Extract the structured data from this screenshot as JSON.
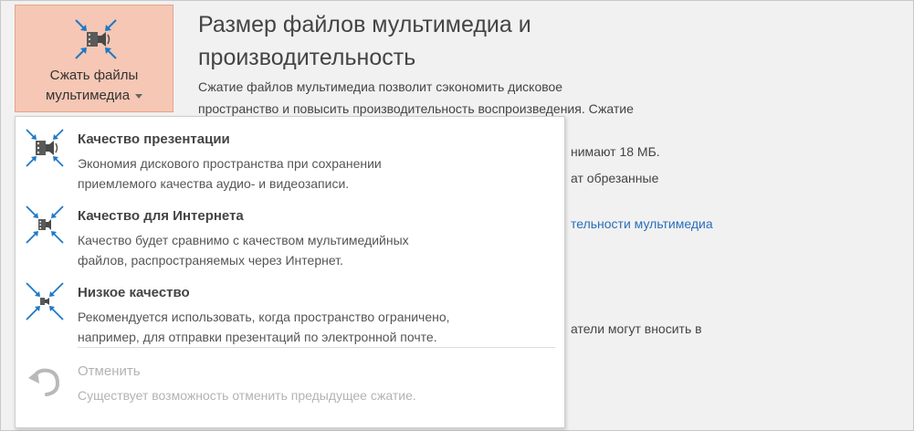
{
  "compress_button": {
    "label_line1": "Сжать файлы",
    "label_line2": "мультимедиа",
    "icon": "compress-media-icon"
  },
  "section": {
    "title_line1": "Размер файлов мультимедиа и",
    "title_line2": "производительность",
    "desc_line1": "Сжатие файлов мультимедиа позволит сэкономить дисковое",
    "desc_line2": "пространство и повысить производительность воспроизведения. Сжатие",
    "partial_size": "нимают 18 МБ.",
    "partial_trimmed": "ат обрезанные",
    "partial_link": "тельности мультимедиа",
    "partial_editors": "атели могут вносить в"
  },
  "menu": {
    "items": [
      {
        "title": "Качество презентации",
        "desc_line1": "Экономия дискового пространства при сохранении",
        "desc_line2": "приемлемого качества аудио- и видеозаписи.",
        "icon": "presentation-quality-icon"
      },
      {
        "title": "Качество для Интернета",
        "desc_line1": "Качество будет сравнимо с качеством мультимедийных",
        "desc_line2": "файлов, распространяемых через Интернет.",
        "icon": "internet-quality-icon"
      },
      {
        "title": "Низкое качество",
        "desc_line1": "Рекомендуется использовать, когда пространство ограничено,",
        "desc_line2": "например, для отправки презентаций по электронной почте.",
        "icon": "low-quality-icon"
      },
      {
        "title": "Отменить",
        "desc_line1": "Существует возможность отменить предыдущее сжатие.",
        "icon": "undo-icon"
      }
    ]
  },
  "colors": {
    "button_bg": "#f5c7b4",
    "link": "#2a6ebb",
    "icon_blue": "#1e78c8"
  }
}
